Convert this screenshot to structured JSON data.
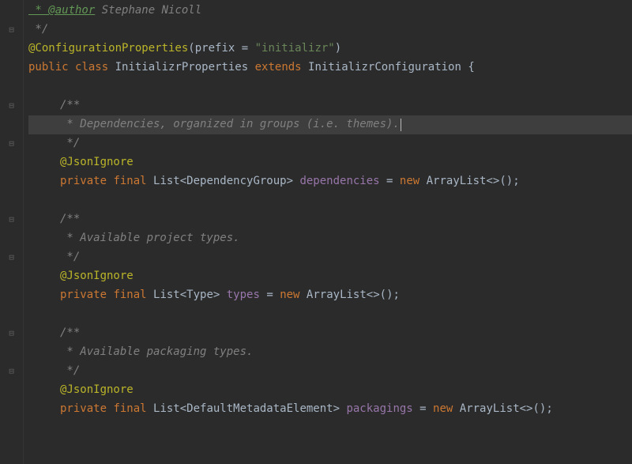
{
  "gutter": {
    "marks": [
      "",
      "⊟",
      "",
      "",
      "",
      "⊟",
      "",
      "⊟",
      "",
      "",
      "",
      "⊟",
      "",
      "⊟",
      "",
      "",
      "",
      "⊟",
      "",
      "⊟",
      "",
      "",
      ""
    ]
  },
  "code": {
    "line1_author_tag": " * @author",
    "line1_author_name": " Stephane Nicoll",
    "line2_close": " */",
    "line3_annotation": "@ConfigurationProperties",
    "line3_paren_open": "(",
    "line3_prefix_key": "prefix = ",
    "line3_prefix_val": "\"initializr\"",
    "line3_paren_close": ")",
    "line4_public": "public ",
    "line4_class": "class ",
    "line4_name": "InitializrProperties ",
    "line4_extends": "extends ",
    "line4_parent": "InitializrConfiguration {",
    "line5_empty": "",
    "line6_open": "/**",
    "line7_comment": " * Dependencies, organized in groups (i.e. themes).",
    "line8_close": " */",
    "line9_annotation": "@JsonIgnore",
    "line10_private": "private ",
    "line10_final": "final ",
    "line10_list": "List",
    "line10_generic": "<DependencyGroup> ",
    "line10_field": "dependencies",
    "line10_eq": " = ",
    "line10_new": "new ",
    "line10_ctor": "ArrayList<>();",
    "line11_empty": "",
    "line12_open": "/**",
    "line13_comment": " * Available project types.",
    "line14_close": " */",
    "line15_annotation": "@JsonIgnore",
    "line16_private": "private ",
    "line16_final": "final ",
    "line16_list": "List",
    "line16_generic": "<Type> ",
    "line16_field": "types",
    "line16_eq": " = ",
    "line16_new": "new ",
    "line16_ctor": "ArrayList<>();",
    "line17_empty": "",
    "line18_open": "/**",
    "line19_comment": " * Available packaging types.",
    "line20_close": " */",
    "line21_annotation": "@JsonIgnore",
    "line22_private": "private ",
    "line22_final": "final ",
    "line22_list": "List",
    "line22_generic": "<DefaultMetadataElement> ",
    "line22_field": "packagings",
    "line22_eq": " = ",
    "line22_new": "new ",
    "line22_ctor": "ArrayList<>();"
  }
}
